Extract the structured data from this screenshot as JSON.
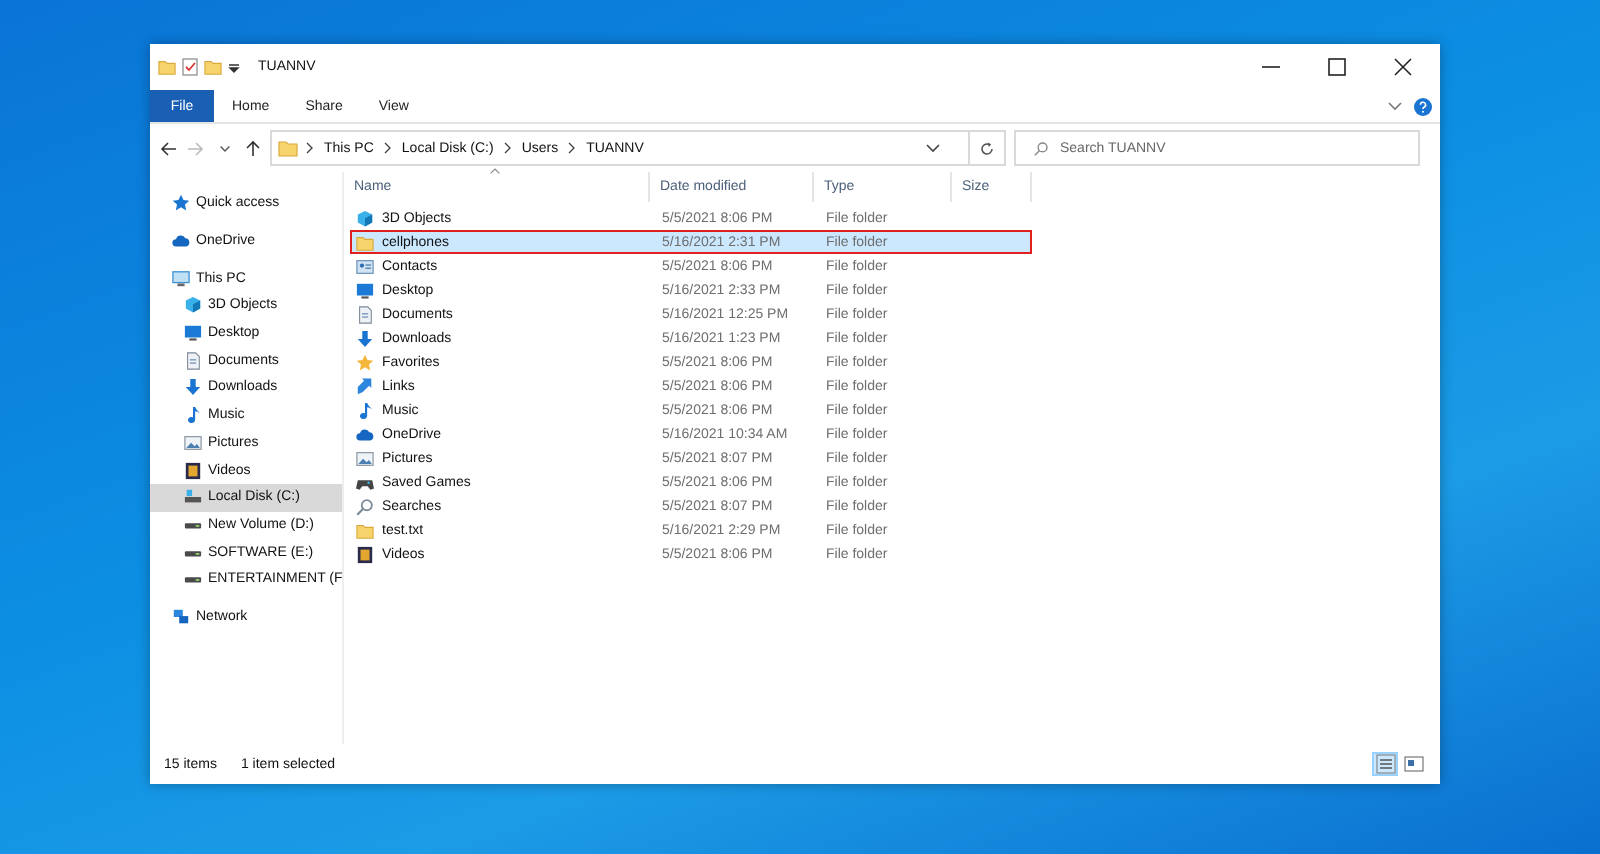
{
  "window": {
    "title": "TUANNV"
  },
  "ribbon": {
    "file_tab": "File",
    "tabs": [
      {
        "label": "Home",
        "selected": false
      },
      {
        "label": "Share",
        "selected": false
      },
      {
        "label": "View",
        "selected": false
      }
    ]
  },
  "address_bar": {
    "path": [
      "This PC",
      "Local Disk (C:)",
      "Users",
      "TUANNV"
    ]
  },
  "search": {
    "placeholder": "Search TUANNV"
  },
  "sidebar": {
    "items": [
      {
        "label": "Quick access",
        "selected": false
      },
      {
        "label": "OneDrive",
        "selected": false
      },
      {
        "label": "This PC",
        "selected": false,
        "children": [
          {
            "label": "3D Objects",
            "selected": false
          },
          {
            "label": "Desktop",
            "selected": false
          },
          {
            "label": "Documents",
            "selected": false
          },
          {
            "label": "Downloads",
            "selected": false
          },
          {
            "label": "Music",
            "selected": false
          },
          {
            "label": "Pictures",
            "selected": false
          },
          {
            "label": "Videos",
            "selected": false
          },
          {
            "label": "Local Disk (C:)",
            "selected": true
          },
          {
            "label": "New Volume (D:)",
            "selected": false
          },
          {
            "label": "SOFTWARE (E:)",
            "selected": false
          },
          {
            "label": "ENTERTAINMENT (F",
            "selected": false
          }
        ]
      },
      {
        "label": "Network",
        "selected": false
      }
    ]
  },
  "table": {
    "columns": [
      "Name",
      "Date modified",
      "Type",
      "Size"
    ],
    "rows": [
      {
        "name": "3D Objects",
        "date": "5/5/2021 8:06 PM",
        "type": "File folder",
        "selected": false
      },
      {
        "name": "cellphones",
        "date": "5/16/2021 2:31 PM",
        "type": "File folder",
        "selected": true
      },
      {
        "name": "Contacts",
        "date": "5/5/2021 8:06 PM",
        "type": "File folder",
        "selected": false
      },
      {
        "name": "Desktop",
        "date": "5/16/2021 2:33 PM",
        "type": "File folder",
        "selected": false
      },
      {
        "name": "Documents",
        "date": "5/16/2021 12:25 PM",
        "type": "File folder",
        "selected": false
      },
      {
        "name": "Downloads",
        "date": "5/16/2021 1:23 PM",
        "type": "File folder",
        "selected": false
      },
      {
        "name": "Favorites",
        "date": "5/5/2021 8:06 PM",
        "type": "File folder",
        "selected": false
      },
      {
        "name": "Links",
        "date": "5/5/2021 8:06 PM",
        "type": "File folder",
        "selected": false
      },
      {
        "name": "Music",
        "date": "5/5/2021 8:06 PM",
        "type": "File folder",
        "selected": false
      },
      {
        "name": "OneDrive",
        "date": "5/16/2021 10:34 AM",
        "type": "File folder",
        "selected": false
      },
      {
        "name": "Pictures",
        "date": "5/5/2021 8:07 PM",
        "type": "File folder",
        "selected": false
      },
      {
        "name": "Saved Games",
        "date": "5/5/2021 8:06 PM",
        "type": "File folder",
        "selected": false
      },
      {
        "name": "Searches",
        "date": "5/5/2021 8:07 PM",
        "type": "File folder",
        "selected": false
      },
      {
        "name": "test.txt",
        "date": "5/16/2021 2:29 PM",
        "type": "File folder",
        "selected": false
      },
      {
        "name": "Videos",
        "date": "5/5/2021 8:06 PM",
        "type": "File folder",
        "selected": false
      }
    ]
  },
  "status_bar": {
    "item_count": "15 items",
    "selection": "1 item selected",
    "views": [
      {
        "kind": "details",
        "selected": true
      },
      {
        "kind": "thumbnails",
        "selected": false
      }
    ]
  }
}
